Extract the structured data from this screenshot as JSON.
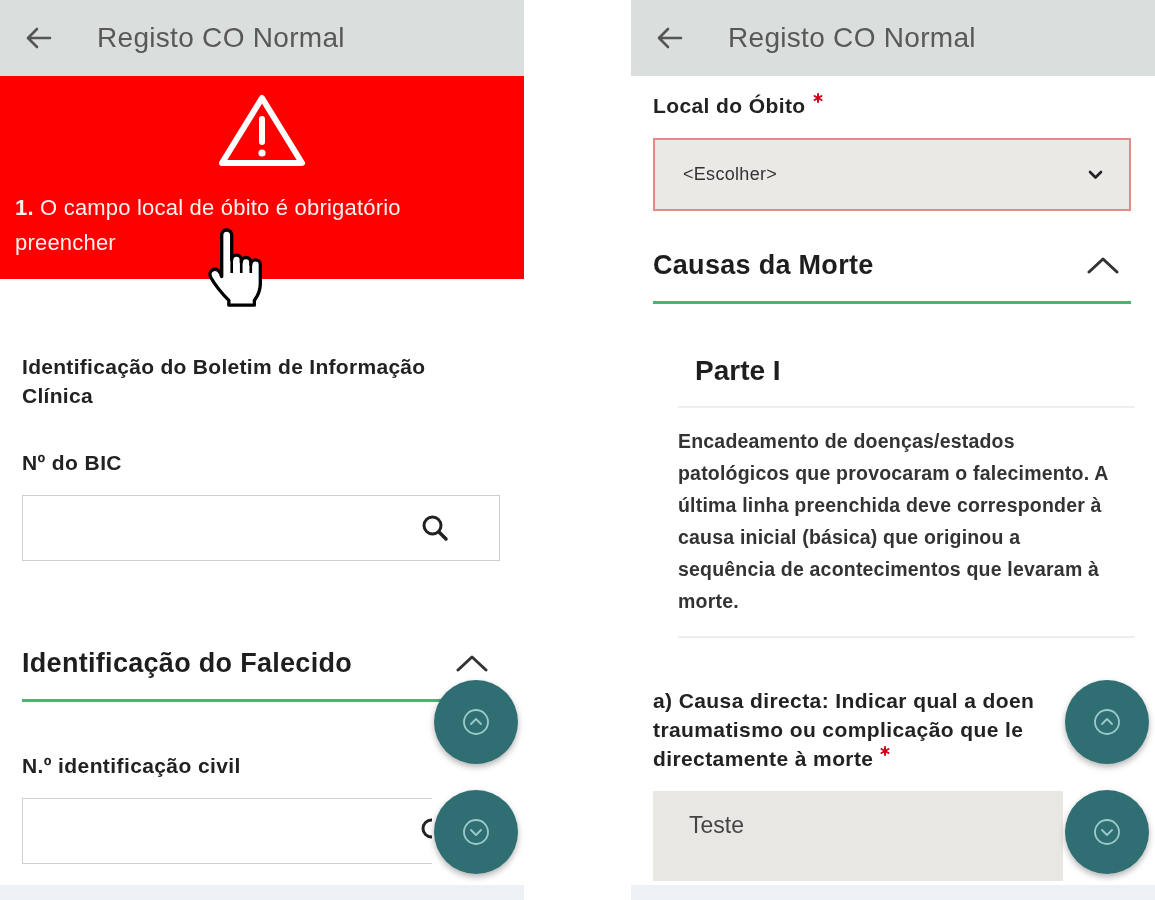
{
  "screens": [
    {
      "app_bar": {
        "title": "Registo CO Normal"
      },
      "blocks": [
        {
          "kind": "error_banner",
          "message": "**1.** O campo local de óbito é obrigatório preencher",
          "pointer_cursor": true
        },
        {
          "kind": "heading",
          "text": "Identificação do Boletim de Informação Clínica"
        },
        {
          "kind": "label",
          "lines": [
            "Nº do BIC"
          ],
          "required": false
        },
        {
          "kind": "search_field"
        },
        {
          "kind": "section",
          "title": "Identificação do Falecido",
          "expanded": true
        },
        {
          "kind": "label",
          "lines": [
            "N.º identificação civil"
          ],
          "required": false
        },
        {
          "kind": "search_field"
        }
      ]
    },
    {
      "app_bar": {
        "title": "Registo CO Normal"
      },
      "blocks": [
        {
          "kind": "label",
          "lines": [
            "Local do Óbito"
          ],
          "required": true
        },
        {
          "kind": "select",
          "placeholder": "<Escolher>",
          "invalid": true
        },
        {
          "kind": "section",
          "title": "Causas da Morte",
          "expanded": true
        },
        {
          "kind": "subsection",
          "title": "Parte I",
          "text": "Encadeamento de doenças/estados patológicos que provocaram o falecimento. A última linha preenchida deve corresponder à causa inicial (básica) que originou a sequência de acontecimentos que levaram à morte."
        },
        {
          "kind": "label",
          "lines": [
            "a) Causa directa: Indicar qual a doen",
            "traumatismo ou complicação que le",
            "directamente à morte"
          ],
          "required": true
        },
        {
          "kind": "text_field",
          "value": "Teste"
        }
      ]
    }
  ]
}
